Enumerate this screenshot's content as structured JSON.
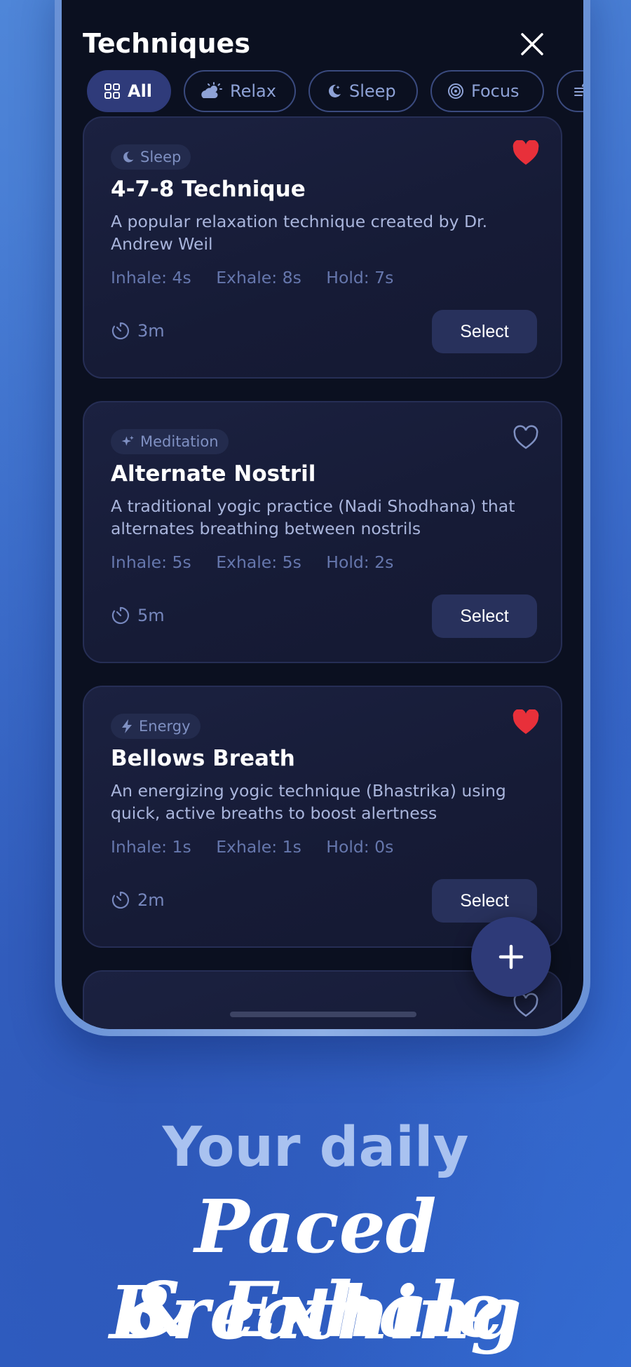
{
  "header": {
    "title": "Techniques"
  },
  "filters": [
    {
      "label": "All",
      "icon": "grid-icon",
      "active": true
    },
    {
      "label": "Relax",
      "icon": "cloud-sun-icon",
      "active": false
    },
    {
      "label": "Sleep",
      "icon": "moon-icon",
      "active": false
    },
    {
      "label": "Focus",
      "icon": "target-icon",
      "active": false
    },
    {
      "label": "",
      "icon": "wind-icon",
      "active": false
    }
  ],
  "cards": [
    {
      "tag": "Sleep",
      "tag_icon": "moon-icon",
      "title": "4-7-8 Technique",
      "description": "A popular relaxation technique created by Dr. Andrew Weil",
      "inhale": "Inhale: 4s",
      "exhale": "Exhale: 8s",
      "hold": "Hold: 7s",
      "duration": "3m",
      "favorite": true,
      "select_label": "Select"
    },
    {
      "tag": "Meditation",
      "tag_icon": "sparkle-icon",
      "title": "Alternate Nostril",
      "description": "A traditional yogic practice (Nadi Shodhana) that alternates breathing between nostrils",
      "inhale": "Inhale: 5s",
      "exhale": "Exhale: 5s",
      "hold": "Hold: 2s",
      "duration": "5m",
      "favorite": false,
      "select_label": "Select"
    },
    {
      "tag": "Energy",
      "tag_icon": "bolt-icon",
      "title": "Bellows Breath",
      "description": "An energizing yogic technique (Bhastrika) using quick, active breaths to boost alertness",
      "inhale": "Inhale: 1s",
      "exhale": "Exhale: 1s",
      "hold": "Hold: 0s",
      "duration": "2m",
      "favorite": true,
      "select_label": "Select"
    }
  ],
  "colors": {
    "favorite": "#e8303a",
    "accent": "#2f3b7a",
    "background": "#0b1020"
  },
  "marketing": {
    "tagline": "Your daily",
    "headline_line1": "Paced Breathing",
    "headline_line2": "& Exhale"
  }
}
